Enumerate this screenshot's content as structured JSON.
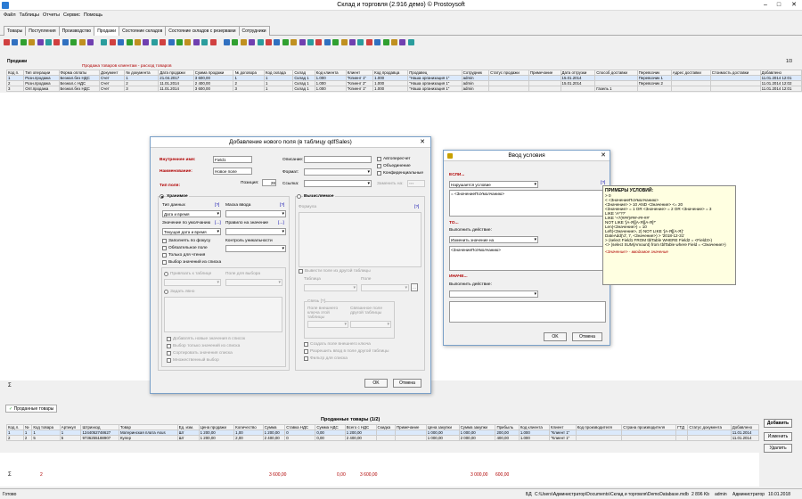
{
  "app": {
    "title": "Склад и торговля (2.916 демо) © Prostoysoft"
  },
  "menu": [
    "Файл",
    "Таблицы",
    "Отчеты",
    "Сервис",
    "Помощь"
  ],
  "tabs": [
    "Товары",
    "Поступления",
    "Производство",
    "Продажи",
    "Состояние складов",
    "Состояние складов с резервами",
    "Сотрудники"
  ],
  "sales": {
    "section_label": "Продажи",
    "page_indicator": "1/3",
    "banner": "Продажа товаров клиентам - расход товаров",
    "columns": [
      "Код п.",
      "Тип операции",
      "Форма оплаты",
      "Документ",
      "№ документа",
      "Дата продажи",
      "Сумма продажи",
      "№ договора",
      "Код склада",
      "Склад",
      "Код клиента",
      "Клиент",
      "Код продавца",
      "Продавец",
      "Сотрудник",
      "Статус продажи",
      "Примечание",
      "Дата отгрузки",
      "Способ доставки",
      "Перевозчик",
      "Адрес доставки",
      "Стоимость доставки",
      "Добавлено"
    ],
    "rows": [
      [
        "1",
        "Розн.продажа",
        "Безнал.без НДС",
        "Счет",
        "1",
        "21.04.2017",
        "3 600,00",
        "1",
        "1",
        "Склад 1",
        "1.000",
        "\"Клиент 1\"",
        "1.000",
        "\"Наша организация 1\"",
        "admin",
        "",
        "",
        "15.01.2014",
        "",
        "Перевозчик 1",
        "",
        "",
        "11.01.2014 12:01"
      ],
      [
        "2",
        "Розн.продажа",
        "Безнал.с НДС",
        "Счет",
        "2",
        "11.01.2014",
        "2 400,00",
        "2",
        "1",
        "Склад 1",
        "1.000",
        "\"Клиент 2\"",
        "1.000",
        "\"Наша организация 1\"",
        "admin",
        "",
        "",
        "15.01.2014",
        "",
        "Перевозчик 2",
        "",
        "",
        "11.01.2014 12:02"
      ],
      [
        "3",
        "Опт.продажа",
        "Безнал.без НДС",
        "Счет",
        "3",
        "11.01.2014",
        "3 600,00",
        "3",
        "1",
        "Склад 1",
        "1.000",
        "\"Клиент 1\"",
        "1.000",
        "\"Наша организация 1\"",
        "admin",
        "",
        "",
        "",
        "Газель 1",
        "",
        "",
        "",
        "11.01.2014 12:01"
      ]
    ],
    "sum_marker": "Σ"
  },
  "sold_goods": {
    "tab_label": "Проданные товары",
    "section_label": "Проданные товары (1/2)",
    "columns": [
      "Код л.",
      "№",
      "Код товара",
      "Артикул",
      "Штрихкод",
      "Товар",
      "Ед. изм.",
      "Цена продажи",
      "Количество",
      "Сумма",
      "Ставка НДС",
      "Сумма НДС",
      "Всего с НДС",
      "Скидка",
      "Примечание",
      "Цена закупки",
      "Сумма закупки",
      "Прибыль",
      "Код клиента",
      "Клиент",
      "Код производителя",
      "Страна производителя",
      "ГТД",
      "Статус документа",
      "Добавлено"
    ],
    "rows": [
      [
        "1",
        "1",
        "1",
        "1",
        "1244052748627",
        "Материнская плата Asus",
        "Шт",
        "1 200,00",
        "1,00",
        "1 200,00",
        "0",
        "0,00",
        "1 200,00",
        "",
        "",
        "1 000,00",
        "1 000,00",
        "200,00",
        "1.000",
        "\"Клиент 1\"",
        "",
        "",
        "",
        "",
        "11.01.2014"
      ],
      [
        "2",
        "2",
        "5",
        "5",
        "9736255188907",
        "Кулер",
        "Шт",
        "1 200,00",
        "2,00",
        "2 400,00",
        "0",
        "0,00",
        "2 400,00",
        "",
        "",
        "1 000,00",
        "2 000,00",
        "400,00",
        "1.000",
        "\"Клиент 1\"",
        "",
        "",
        "",
        "",
        "11.01.2014"
      ]
    ],
    "totals": {
      "count": "2",
      "sum": "3 600,00",
      "vat": "0,00",
      "total": "3 600,00",
      "purchase": "3 000,00",
      "profit": "600,00"
    },
    "buttons": [
      "Добавить",
      "Изменить",
      "Удалить"
    ]
  },
  "add_field_dialog": {
    "title": "Добавление нового поля (в таблицу qdfSales)",
    "internal_name_label": "Внутреннее имя:",
    "internal_name_value": "Field1",
    "name_label": "Наименование:",
    "name_value": "Новое поле",
    "description_label": "Описание:",
    "format_label": "Формат:",
    "link_label": "Ссылка:",
    "field_type_label": "Тип поля:",
    "position_label": "Позиция:",
    "position_value": "28",
    "autoincrement": "Автопересчет",
    "merge": "Объединение",
    "confidential": "Конфиденциальные",
    "replace_label": "Заменить на:",
    "replace_value": "***",
    "stored_label": "Хранимое",
    "computed_label": "Вычисляемое",
    "data_type_label": "Тип данных",
    "data_type_help": "[?]",
    "data_type_value": "Дата и время",
    "input_mask_label": "Маска ввода",
    "input_mask_help": "[?]",
    "default_label": "Значение по умолчанию",
    "default_help": "[...]",
    "default_value": "Текущая дата и время",
    "validation_label": "Правило на значение",
    "validation_help": "[...]",
    "fill_focus": "Заполнять по фокусу",
    "uniqueness": "Контроль уникальности",
    "required": "Обязательное поле",
    "readonly": "Только для чтения",
    "choose_from_list": "Выбор значений из списка",
    "bind_table": "Привязать к таблице",
    "field_for_choice": "Поле для выбора",
    "set_manually": "Задать явно",
    "add_new_values": "Добавлять новые значения в список",
    "choose_only_from_list": "Выбор только значений из списка",
    "sort_values": "Сортировать значения списка",
    "multiselect": "Множественный выбор",
    "formula_label": "Формула",
    "formula_help": "[?]",
    "output_from_table": "Вывести поле из другой таблицы",
    "table_label": "Таблица",
    "field_label": "Поле",
    "link_group": "Связь [?]",
    "ext_key_label": "Поле внешнего ключа этой таблицы",
    "linked_field_label": "Связанное поле другой таблицы",
    "create_ext_key": "Создать поле внешнего ключа",
    "allow_edit_other": "Разрешить ввод в поле другой таблицы",
    "filter_for_list": "Фильтр для списка",
    "ok": "OK",
    "cancel": "Отмена"
  },
  "condition_dialog": {
    "title": "Ввод условия",
    "if_label": "ЕСЛИ...",
    "if_select": "Нарушается условие",
    "if_help": "[?]",
    "if_text": "= <ЗначениеПоУмолчанию>",
    "then_label": "ТО...",
    "then_action_label": "Выполнить действие:",
    "then_select": "Изменить значение на",
    "then_text": "<ЗначениеПоУмолчанию>",
    "else_label": "ИНАЧЕ...",
    "else_action_label": "Выполнить действие:",
    "ok": "OK",
    "cancel": "Отмена"
  },
  "tooltip": {
    "title": "ПРИМЕРЫ УСЛОВИЙ:",
    "lines": [
      "> 0",
      "< <ЗначениеПоУмолчанию>",
      "<Значение> > 10 AND <Значение> <= 20",
      "<Значение> = 1 OR <Значение> = 2 OR <Значение> = 3",
      "LIKE 'А*??'",
      "LIKE '+7(###)###-##-##'",
      "NOT LIKE '[А-Я][А-Я][А-Я]*'",
      "Len(<Значение>) = 10",
      "Left(<Значение>, 2) NOT LIKE '[А-Я][А-Я]'",
      "DateAdd('d', 7, <Значение>) > '2018-12-31'",
      "> (select Field1 FROM tblTable WHERE Field2 = <Field3>)",
      "<> (select SUM(Amount) from tblTable where Field = <Значение>)"
    ],
    "footer": "<Значение> - вводимое значение"
  },
  "status": {
    "ready": "Готово",
    "db_label": "БД",
    "db_path": "C:\\Users\\Администратор\\Documents\\Склад и торговля\\DemoDatabase.mdb",
    "size": "2 896 Kb",
    "user": "admin",
    "role": "Администратор",
    "date": "10.01.2018"
  }
}
